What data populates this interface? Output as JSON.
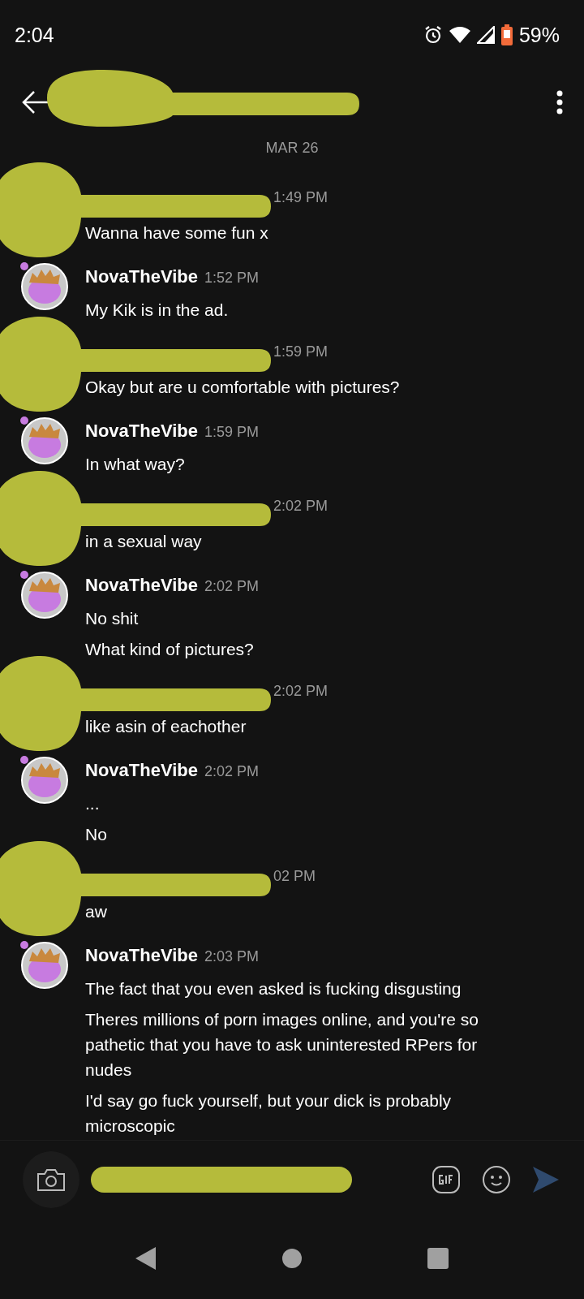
{
  "status_bar": {
    "time": "2:04",
    "battery": "59%"
  },
  "header": {
    "redacted": true
  },
  "date_divider": "MAR 26",
  "messages": [
    {
      "kind": "redacted",
      "time": "1:49 PM",
      "lines": [
        "Wanna have some fun x"
      ]
    },
    {
      "kind": "user",
      "name": "NovaTheVibe",
      "time": "1:52 PM",
      "lines": [
        "My Kik is in the ad."
      ]
    },
    {
      "kind": "redacted",
      "time": "1:59 PM",
      "lines": [
        "Okay but are u comfortable with pictures?"
      ]
    },
    {
      "kind": "user",
      "name": "NovaTheVibe",
      "time": "1:59 PM",
      "lines": [
        "In what way?"
      ]
    },
    {
      "kind": "redacted",
      "time": "2:02 PM",
      "lines": [
        "in a sexual way"
      ]
    },
    {
      "kind": "user",
      "name": "NovaTheVibe",
      "time": "2:02 PM",
      "lines": [
        "No shit",
        "What kind of pictures?"
      ]
    },
    {
      "kind": "redacted",
      "time": "2:02 PM",
      "lines": [
        "like asin of eachother"
      ]
    },
    {
      "kind": "user",
      "name": "NovaTheVibe",
      "time": "2:02 PM",
      "lines": [
        "...",
        "No"
      ]
    },
    {
      "kind": "redacted",
      "time": "02 PM",
      "lines": [
        "aw"
      ]
    },
    {
      "kind": "user",
      "name": "NovaTheVibe",
      "time": "2:03 PM",
      "lines": [
        "The fact that you even asked is fucking disgusting",
        "Theres millions of porn images online, and you're so pathetic that you have to ask uninterested RPers for nudes",
        "I'd say go fuck yourself, but your dick is probably microscopic"
      ]
    }
  ],
  "composer": {
    "redacted": true
  }
}
